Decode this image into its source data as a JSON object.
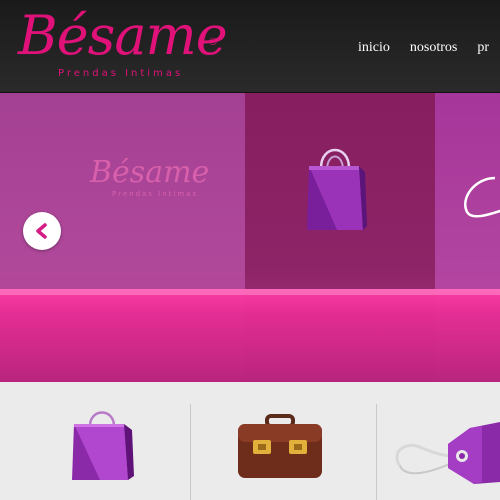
{
  "brand": {
    "name": "Bésame",
    "registered_mark": "®",
    "tagline": "Prendas Intimas",
    "color": "#e0127a"
  },
  "nav": {
    "items": [
      "inicio",
      "nosotros",
      "pr"
    ]
  },
  "slider": {
    "watermark_name": "Bésame",
    "watermark_tagline": "Prendas Intimas",
    "prev_icon": "chevron-left-icon",
    "slide_icon": "shopping-bag-icon"
  },
  "features": {
    "icons": [
      "shopping-bag-icon",
      "briefcase-icon",
      "price-tag-icon"
    ]
  },
  "colors": {
    "accent": "#e0127a",
    "header_bg": "#1f1f1f",
    "slider_pink": "#e82d95",
    "features_bg": "#ebebeb"
  }
}
